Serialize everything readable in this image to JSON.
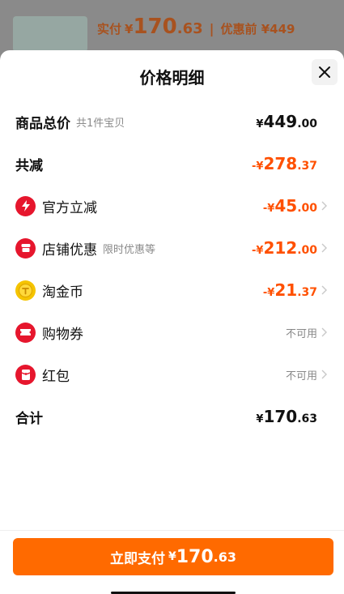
{
  "background": {
    "paid_label": "实付",
    "currency": "¥",
    "paid_int": "170",
    "paid_dec": ".63",
    "separator": "|",
    "before_label": "优惠前 ¥449"
  },
  "sheet": {
    "title": "价格明细"
  },
  "rows": {
    "total": {
      "label": "商品总价",
      "sub": "共1件宝贝",
      "currency": "¥",
      "int": "449",
      "dec": ".00"
    },
    "discount": {
      "label": "共减",
      "currency": "-¥",
      "int": "278",
      "dec": ".37"
    },
    "official": {
      "label": "官方立减",
      "currency": "-¥",
      "int": "45",
      "dec": ".00"
    },
    "shop": {
      "label": "店铺优惠",
      "sub": "限时优惠等",
      "currency": "-¥",
      "int": "212",
      "dec": ".00"
    },
    "coins": {
      "label": "淘金币",
      "currency": "-¥",
      "int": "21",
      "dec": ".37"
    },
    "voucher": {
      "label": "购物券",
      "status": "不可用"
    },
    "redpacket": {
      "label": "红包",
      "status": "不可用"
    },
    "sum": {
      "label": "合计",
      "currency": "¥",
      "int": "170",
      "dec": ".63"
    }
  },
  "pay_button": {
    "label": "立即支付",
    "currency": "¥",
    "int": "170",
    "dec": ".63"
  },
  "icons": {
    "official": "lightning-icon",
    "shop": "shop-icon",
    "coins": "coin-icon",
    "voucher": "ticket-icon",
    "redpacket": "red-packet-icon"
  },
  "colors": {
    "accent": "#ff5000",
    "button": "#ff6a00",
    "red_icon": "#e6162d",
    "gold_icon": "#f5c400"
  }
}
